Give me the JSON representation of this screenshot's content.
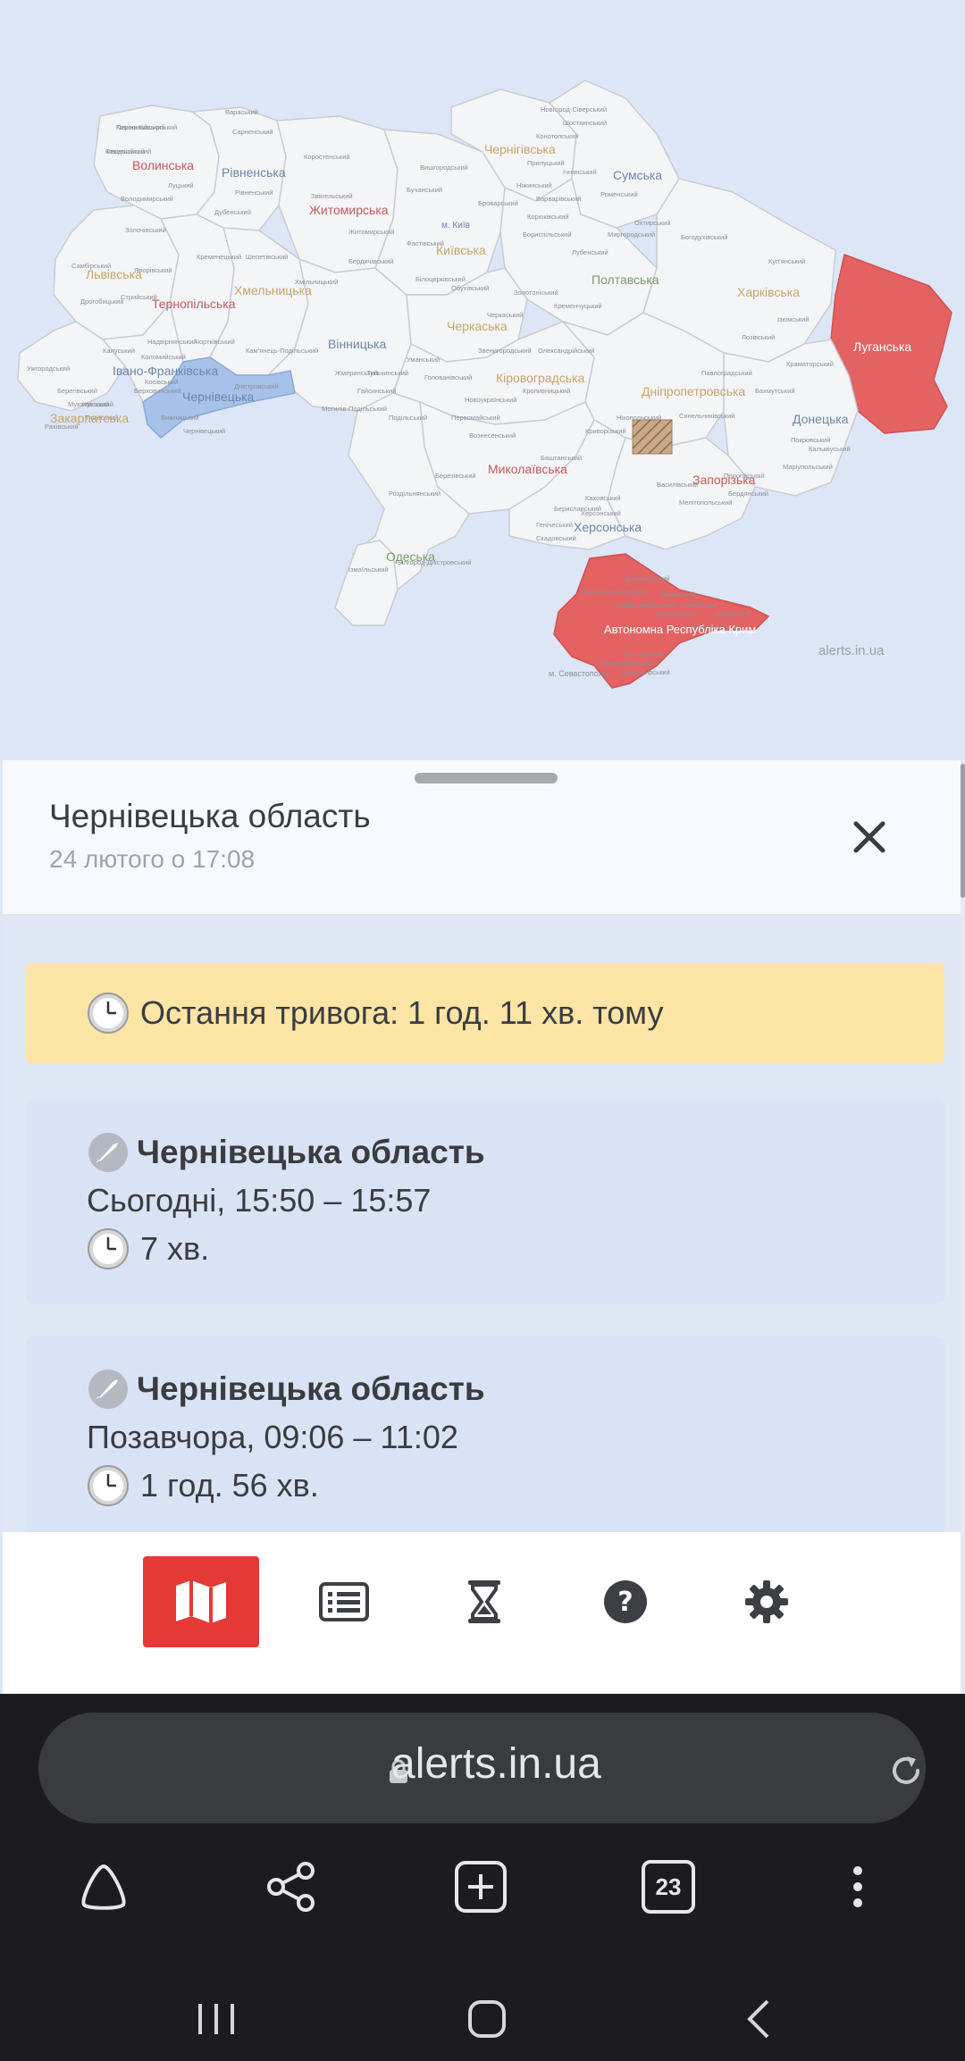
{
  "map": {
    "watermark": "alerts.in.ua",
    "regions": {
      "volynska": "Волинська",
      "rivnenska": "Рівненська",
      "zhytomyrska": "Житомирська",
      "chernihivska": "Чернігівська",
      "sumska": "Сумська",
      "kharkivska": "Харківська",
      "luhanska": "Луганська",
      "donetska": "Донецька",
      "zaporizka": "Запорізька",
      "khersonska": "Херсонська",
      "crimea": "Автономна Республіка Крим",
      "sevastopol": "м. Севастополь",
      "odeska": "Одеська",
      "mykolaivska": "Миколаївська",
      "kirovohradska": "Кіровоградська",
      "dnipropetrovska": "Дніпропетровська",
      "poltavska": "Полтавська",
      "kyivska": "Київська",
      "kyiv": "м. Київ",
      "cherkaska": "Черкаська",
      "vinnytska": "Вінницька",
      "khmelnytska": "Хмельницька",
      "ternopilska": "Тернопільська",
      "lvivska": "Львівська",
      "ivano_frankivska": "Івано-Франківська",
      "zakarpatska": "Закарпатська",
      "chernivetska": "Чернівецька"
    },
    "raions": [
      "Камінь-Каширський",
      "Ковельський",
      "Луцький",
      "Володимирський",
      "Сарненський",
      "Вараський",
      "Рівненський",
      "Дубенський",
      "Звягельський",
      "Коростенський",
      "Бердичівський",
      "Житомирський",
      "Новгород-Сіверський",
      "Шосткинський",
      "Конотопський",
      "Роменський",
      "Охтирський",
      "Богодухівський",
      "Куп'янський",
      "Ізюмський",
      "Лозівський",
      "Краматорський",
      "Бахмутський",
      "Покровський",
      "Маріупольський",
      "Кальміуський",
      "Пологівський",
      "Бердянський",
      "Мелітопольський",
      "Василівський",
      "Каховський",
      "Скадовський",
      "Генічеський",
      "Бериславський",
      "Херсонський",
      "Баштанський",
      "Вознесенський",
      "Первомайський",
      "Подільський",
      "Роздільнянський",
      "Березівський",
      "Білгород-Дністровський",
      "Ізмаїльський",
      "Голованівський",
      "Новоукраїнський",
      "Кропивницький",
      "Олександрійський",
      "Криворізький",
      "Нікопольський",
      "Павлоградський",
      "Синельниківський",
      "Кременчуцький",
      "Лубенський",
      "Миргородський",
      "Уманський",
      "Звенигородський",
      "Золотоніський",
      "Черкаський",
      "Бучанський",
      "Вишгородський",
      "Броварський",
      "Фастівський",
      "Білоцерківський",
      "Обухівський",
      "Бориспільський",
      "Тульчинський",
      "Гайсинський",
      "Жмеринський",
      "Могилів-Подільський",
      "Хмільницький",
      "Шепетівський",
      "Кам'янець-Подільський",
      "Чортківський",
      "Кременецький",
      "Золочівський",
      "Стрийський",
      "Дрогобицький",
      "Самбірський",
      "Яворівський",
      "Калуський",
      "Коломийський",
      "Косівський",
      "Верховинський",
      "Надвірнянський",
      "Мукачівський",
      "Ужгородський",
      "Берегівський",
      "Тячівський",
      "Рахівський",
      "Хустський",
      "Дністровський",
      "Вижницький",
      "Чернівецький",
      "Ніжинський",
      "Прилуцький",
      "Корюківський",
      "Варварівський",
      "Ічнянський",
      "Сімферопольський",
      "Джанкойський",
      "Красноперекопський",
      "Бахчисарайський",
      "Ялтинський",
      "Білогірський",
      "Кіровський",
      "Совєтський",
      "Ленінський",
      "Старокримський",
      "Нижньогірський",
      "Первомайський",
      "Феодосійський"
    ]
  },
  "sheet": {
    "title": "Чернівецька область",
    "date": "24 лютого о 17:08",
    "last_alert": "Остання тривога: 1 год. 11 хв. тому",
    "events": [
      {
        "region": "Чернівецька область",
        "time": "Сьогодні, 15:50 – 15:57",
        "duration": "7 хв."
      },
      {
        "region": "Чернівецька область",
        "time": "Позавчора, 09:06 – 11:02",
        "duration": "1 год. 56 хв."
      }
    ]
  },
  "nav": {
    "items": [
      "map-icon",
      "list-icon",
      "hourglass-icon",
      "help-icon",
      "settings-icon"
    ],
    "active_index": 0,
    "active_color": "#e53935"
  },
  "browser": {
    "url": "alerts.in.ua",
    "tab_count": "23"
  },
  "colors": {
    "alert": "#e46262",
    "selected": "#a6c2ea",
    "last_alert_bg": "#fde5a5",
    "card_bg": "#d9e3f6"
  }
}
